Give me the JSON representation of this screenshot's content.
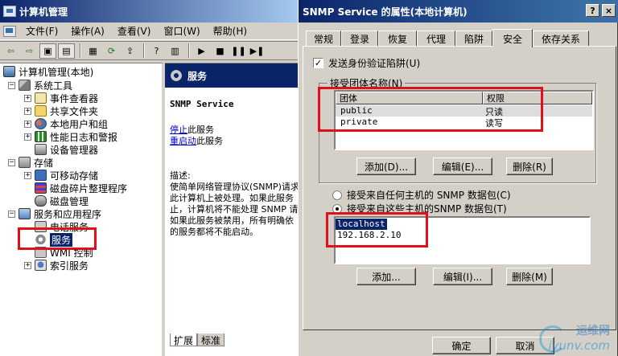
{
  "main_window": {
    "title": "计算机管理",
    "menu": [
      "文件(F)",
      "操作(A)",
      "查看(V)",
      "窗口(W)",
      "帮助(H)"
    ],
    "toolbar_icons": [
      "back-arrow-icon",
      "forward-arrow-icon",
      "up-folder-icon",
      "show-tree-icon",
      "properties-icon",
      "refresh-icon",
      "export-icon",
      "help-icon",
      "play-icon",
      "stop-icon",
      "pause-icon",
      "restart-icon"
    ]
  },
  "tree": [
    {
      "label": "计算机管理(本地)",
      "expander": "",
      "icon": "computer-icon",
      "level": 0
    },
    {
      "label": "系统工具",
      "expander": "−",
      "icon": "system-tools-icon",
      "level": 1
    },
    {
      "label": "事件查看器",
      "expander": "+",
      "icon": "event-viewer-icon",
      "level": 2
    },
    {
      "label": "共享文件夹",
      "expander": "+",
      "icon": "shared-folder-icon",
      "level": 2
    },
    {
      "label": "本地用户和组",
      "expander": "+",
      "icon": "users-icon",
      "level": 2
    },
    {
      "label": "性能日志和警报",
      "expander": "+",
      "icon": "performance-icon",
      "level": 2
    },
    {
      "label": "设备管理器",
      "expander": "",
      "icon": "device-manager-icon",
      "level": 2
    },
    {
      "label": "存储",
      "expander": "−",
      "icon": "storage-icon",
      "level": 1
    },
    {
      "label": "可移动存储",
      "expander": "+",
      "icon": "removable-storage-icon",
      "level": 2
    },
    {
      "label": "磁盘碎片整理程序",
      "expander": "",
      "icon": "defrag-icon",
      "level": 2
    },
    {
      "label": "磁盘管理",
      "expander": "",
      "icon": "disk-management-icon",
      "level": 2
    },
    {
      "label": "服务和应用程序",
      "expander": "−",
      "icon": "services-apps-icon",
      "level": 1
    },
    {
      "label": "电话服务",
      "expander": "",
      "icon": "telephony-icon",
      "level": 2
    },
    {
      "label": "服务",
      "expander": "",
      "icon": "services-gear-icon",
      "level": 2,
      "selected": true
    },
    {
      "label": "WMI 控制",
      "expander": "",
      "icon": "wmi-icon",
      "level": 2
    },
    {
      "label": "索引服务",
      "expander": "+",
      "icon": "indexing-icon",
      "level": 2
    }
  ],
  "detail": {
    "header": "服务",
    "service_name": "SNMP Service",
    "stop_link": "停止",
    "stop_suffix": "此服务",
    "restart_link": "重启动",
    "restart_suffix": "此服务",
    "desc_label": "描述:",
    "desc_lines": [
      "使简单网络管理协议(SNMP)请求",
      "此计算机上被处理。如果此服务",
      "止，计算机将不能处理 SNMP 请",
      "如果此服务被禁用，所有明确依",
      "的服务都将不能启动。"
    ],
    "tabs": [
      "扩展",
      "标准"
    ]
  },
  "dialog": {
    "title": "SNMP Service 的属性(本地计算机)",
    "help_btn": "?",
    "close_btn": "×",
    "tabs": [
      "常规",
      "登录",
      "恢复",
      "代理",
      "陷阱",
      "安全",
      "依存关系"
    ],
    "active_tab": "安全",
    "send_auth_trap_label": "发送身份验证陷阱(U)",
    "send_auth_trap_checked": true,
    "community_group_title": "接受团体名称(N)",
    "community_columns": [
      "团体",
      "权限"
    ],
    "communities": [
      {
        "name": "public",
        "right": "只读"
      },
      {
        "name": "private",
        "right": "读写"
      }
    ],
    "community_buttons": [
      "添加(D)...",
      "编辑(E)...",
      "删除(R)"
    ],
    "radio_any_host": "接受来自任何主机的 SNMP 数据包(C)",
    "radio_these_hosts": "接受来自这些主机的SNMP 数据包(T)",
    "radio_selected": "these_hosts",
    "hosts": [
      "localhost",
      "192.168.2.10"
    ],
    "host_buttons": [
      "添加...",
      "编辑(I)...",
      "删除(M)"
    ],
    "ok": "确定",
    "cancel": "取消"
  },
  "watermark": {
    "cn": "运维网",
    "en": "iyunv.com"
  }
}
